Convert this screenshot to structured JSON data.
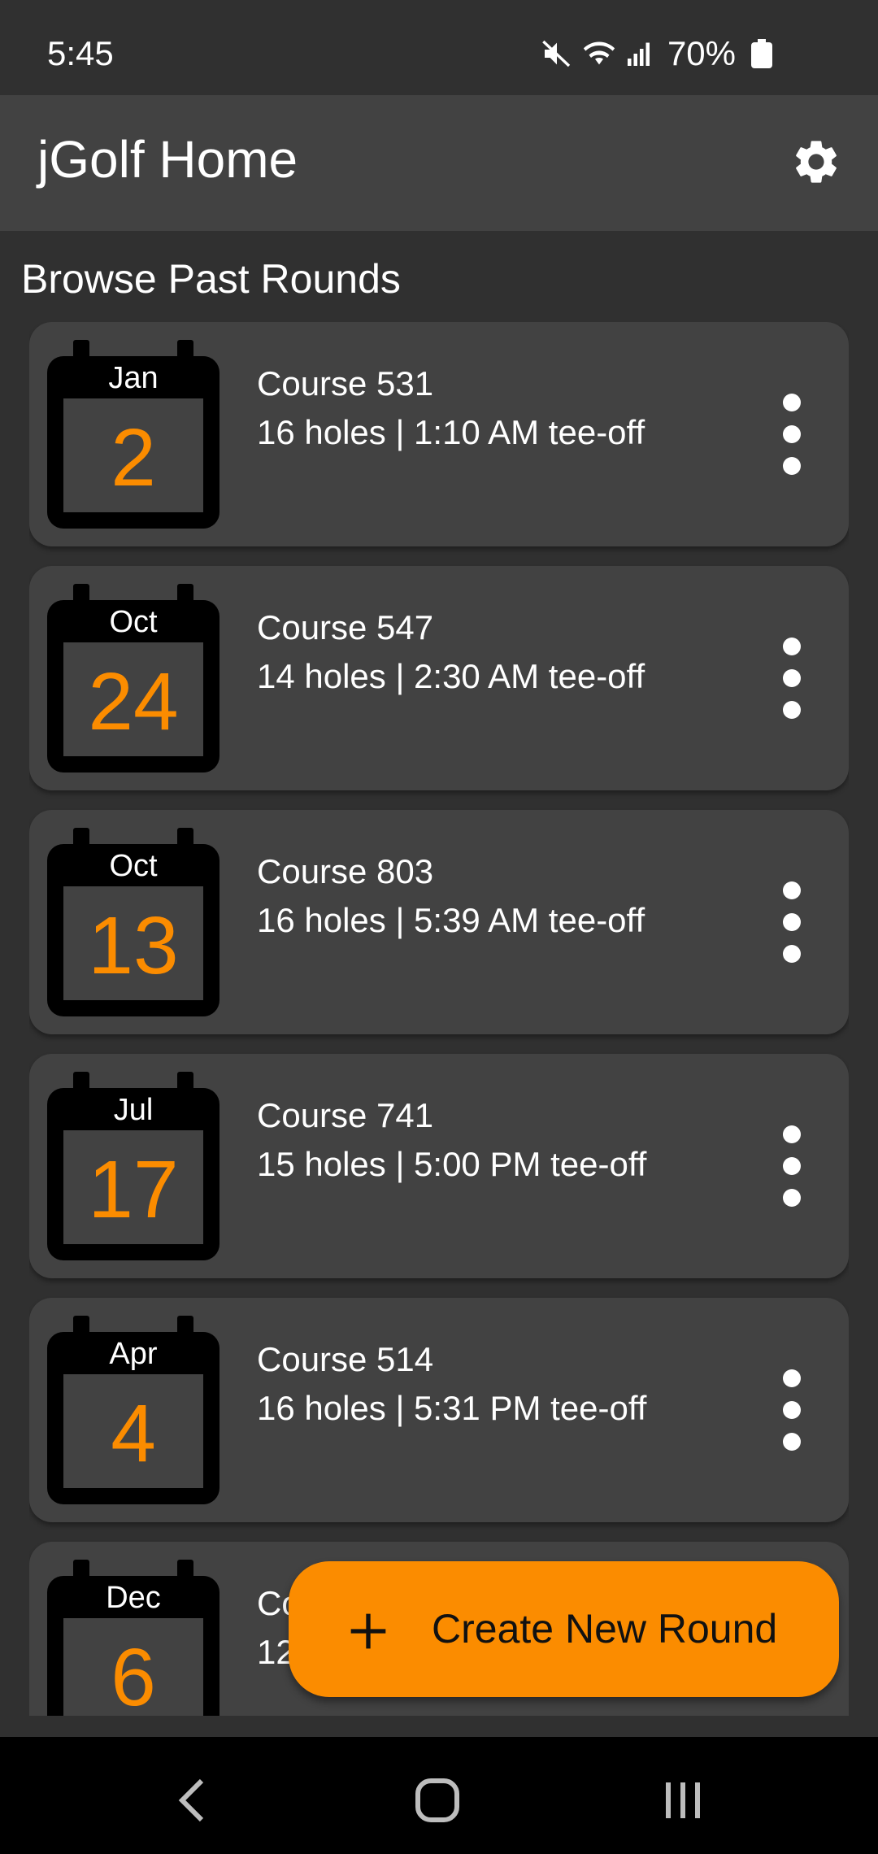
{
  "status_bar": {
    "time": "5:45",
    "battery": "70%",
    "icons": [
      "mute-icon",
      "wifi-icon",
      "signal-icon",
      "battery-icon"
    ]
  },
  "app_bar": {
    "title": "jGolf Home",
    "settings_icon": "gear-icon"
  },
  "section_title": "Browse Past Rounds",
  "rounds": [
    {
      "month": "Jan",
      "day": "2",
      "course": "Course 531",
      "details": "16 holes | 1:10 AM tee-off"
    },
    {
      "month": "Oct",
      "day": "24",
      "course": "Course 547",
      "details": "14 holes | 2:30 AM tee-off"
    },
    {
      "month": "Oct",
      "day": "13",
      "course": "Course 803",
      "details": "16 holes | 5:39 AM tee-off"
    },
    {
      "month": "Jul",
      "day": "17",
      "course": "Course 741",
      "details": "15 holes | 5:00 PM tee-off"
    },
    {
      "month": "Apr",
      "day": "4",
      "course": "Course 514",
      "details": "16 holes | 5:31 PM tee-off"
    },
    {
      "month": "Dec",
      "day": "6",
      "course": "Co",
      "details": "12"
    }
  ],
  "fab": {
    "label": "Create New Round",
    "icon": "plus-icon"
  },
  "colors": {
    "accent": "#fb8c00",
    "background": "#303030",
    "card": "#424242",
    "app_bar": "#424242"
  },
  "nav_bar": {
    "icons": [
      "back-icon",
      "home-icon",
      "recents-icon"
    ]
  }
}
